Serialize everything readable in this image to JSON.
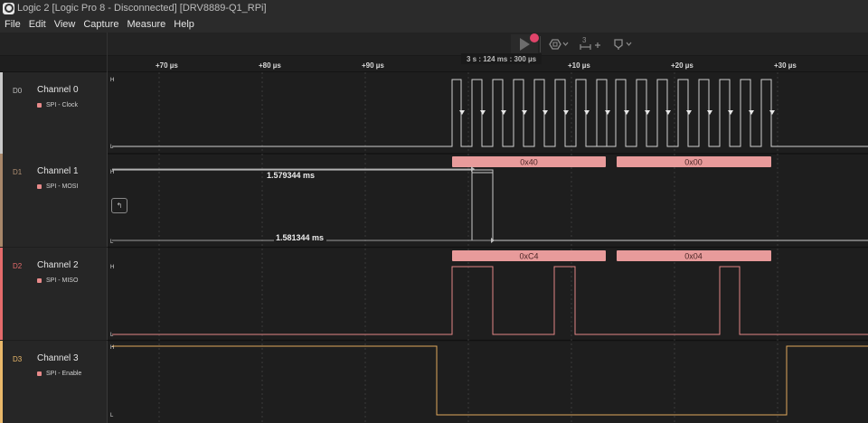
{
  "window": {
    "title": "Logic 2 [Logic Pro 8 - Disconnected] [DRV8889-Q1_RPi]"
  },
  "menu": [
    "File",
    "Edit",
    "View",
    "Capture",
    "Measure",
    "Help"
  ],
  "toolbar": {
    "trigger_count": "3"
  },
  "ruler": {
    "cursor_time": "3 s : 124 ms : 300 µs",
    "ticks": [
      {
        "label": "+70 µs",
        "pos": 65
      },
      {
        "label": "+80 µs",
        "pos": 179
      },
      {
        "label": "+90 µs",
        "pos": 293
      },
      {
        "label": "+10 µs",
        "pos": 522
      },
      {
        "label": "+20 µs",
        "pos": 636
      },
      {
        "label": "+30 µs",
        "pos": 750
      }
    ]
  },
  "channels": [
    {
      "id": "D0",
      "name": "Channel 0",
      "analyzer": "SPI - Clock",
      "color": "#c9c9c9"
    },
    {
      "id": "D1",
      "name": "Channel 1",
      "analyzer": "SPI - MOSI",
      "color": "#a8876a"
    },
    {
      "id": "D2",
      "name": "Channel 2",
      "analyzer": "SPI - MISO",
      "color": "#e46b6b"
    },
    {
      "id": "D3",
      "name": "Channel 3",
      "analyzer": "SPI - Enable",
      "color": "#e9b86a"
    }
  ],
  "levels": {
    "high": "H",
    "low": "L"
  },
  "measurements": {
    "m1": "1.579344 ms",
    "m2": "1.581344 ms"
  },
  "mosi_bytes": [
    "0x40",
    "0x00"
  ],
  "miso_bytes": [
    "0xC4",
    "0x04"
  ],
  "colors": {
    "clock": "#d0d0d0",
    "mosi": "#c9c9c9",
    "miso": "#e38686",
    "enable": "#e0a85c",
    "annotation": "#e89b9b",
    "record": "#e0446a"
  }
}
